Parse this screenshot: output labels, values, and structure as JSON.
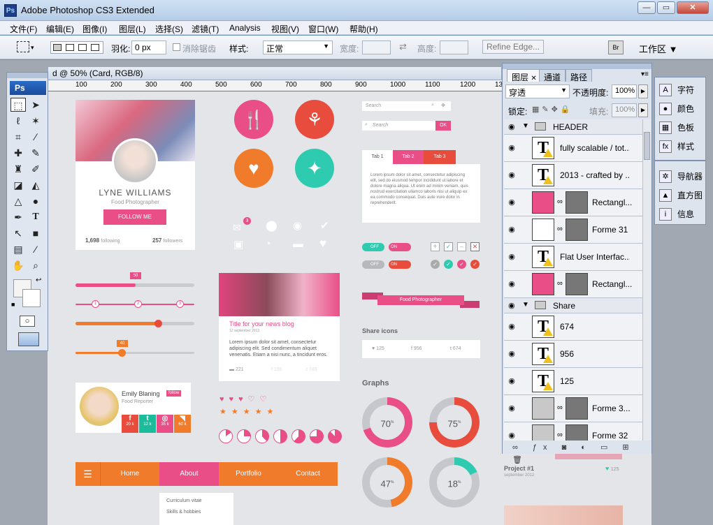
{
  "window": {
    "title": "Adobe Photoshop CS3 Extended",
    "app_icon": "Ps"
  },
  "menu": [
    "文件(F)",
    "编辑(E)",
    "图像(I)",
    "图层(L)",
    "选择(S)",
    "滤镜(T)",
    "Analysis",
    "视图(V)",
    "窗口(W)",
    "帮助(H)"
  ],
  "options": {
    "feather_label": "羽化:",
    "feather_value": "0 px",
    "antialias_label": "消除锯齿",
    "style_label": "样式:",
    "style_value": "正常",
    "width_label": "宽度:",
    "height_label": "高度:",
    "refine_edge": "Refine Edge...",
    "workspace": "工作区 ▼"
  },
  "document": {
    "tab_title": "d @ 50% (Card, RGB/8)",
    "ruler_ticks": [
      "100",
      "200",
      "300",
      "400",
      "500",
      "600",
      "700",
      "800",
      "900",
      "1000",
      "1100",
      "1200",
      "1300"
    ]
  },
  "toolbox": {
    "logo": "Ps"
  },
  "layers_panel": {
    "tabs": [
      "图层",
      "通道",
      "路径"
    ],
    "blend_mode": "穿透",
    "opacity_label": "不透明度:",
    "opacity_value": "100%",
    "lock_label": "锁定:",
    "fill_label": "填充:",
    "fill_value": "100%",
    "rows": [
      {
        "kind": "group",
        "name": "HEADER"
      },
      {
        "kind": "text",
        "name": "fully scalable / tot..."
      },
      {
        "kind": "text",
        "name": "2013 - crafted by ..."
      },
      {
        "kind": "shape",
        "name": "Rectangl...",
        "color": "#e94e86"
      },
      {
        "kind": "shape",
        "name": "Forme 31",
        "color": "#ffffff"
      },
      {
        "kind": "text",
        "name": "Flat User Interfac..."
      },
      {
        "kind": "shape",
        "name": "Rectangl...",
        "color": "#e94e86"
      },
      {
        "kind": "group",
        "name": "Share"
      },
      {
        "kind": "text",
        "name": "674"
      },
      {
        "kind": "text",
        "name": "956"
      },
      {
        "kind": "text",
        "name": "125"
      },
      {
        "kind": "shape",
        "name": "Forme 3...",
        "color": "#c8c8c8"
      },
      {
        "kind": "shape",
        "name": "Forme 32",
        "color": "#c8c8c8"
      }
    ]
  },
  "right_panel": {
    "items": [
      {
        "label": "字符",
        "icon": "A"
      },
      {
        "label": "颜色",
        "icon": "●"
      },
      {
        "label": "色板",
        "icon": "▦"
      },
      {
        "label": "样式",
        "icon": "fx"
      },
      {
        "label": "导航器",
        "icon": "✲"
      },
      {
        "label": "直方图",
        "icon": "▲"
      },
      {
        "label": "信息",
        "icon": "i"
      }
    ]
  },
  "canvas": {
    "profile": {
      "name": "LYNE WILLIAMS",
      "role": "Food Photographer",
      "button": "FOLLOW ME",
      "following_n": "1,698",
      "following_l": "following",
      "followers_n": "257",
      "followers_l": "followers"
    },
    "slider_badges": {
      "a": "50",
      "b": "40"
    },
    "steps": [
      "1",
      "2",
      "3"
    ],
    "user_card": {
      "name": "Emily Blaning",
      "badge": "follow",
      "role": "Food Reporter",
      "stats": [
        {
          "icon": "f",
          "n": "20 k",
          "c": "#e74c3c"
        },
        {
          "icon": "t",
          "n": "12 k",
          "c": "#1abc9c"
        },
        {
          "icon": "◎",
          "n": "35 k",
          "c": "#e94e86"
        },
        {
          "icon": "◥",
          "n": "60 k",
          "c": "#f07b2b"
        }
      ]
    },
    "nav": {
      "items": [
        "Home",
        "About",
        "Portfolio",
        "Contact"
      ],
      "dropdown": [
        "Curriculum vitae",
        "Skills & hobbies"
      ]
    },
    "blog": {
      "title": "Title for your news blog",
      "date": "12 september 2013",
      "body": "Lorem ipsum dolor sit amet, consectetur adipiscing elit. Sed condimentum aliquet venenatis. Etiam a nisi nunc, a tincidunt eros.",
      "c1": "221",
      "c2": "190",
      "c3": "745"
    },
    "search": {
      "placeholder1": "Search",
      "placeholder2": "Search",
      "ok": "OK"
    },
    "tabs": {
      "labels": [
        "Tab 1",
        "Tab 2",
        "Tab 3"
      ],
      "body": "Lorem ipsum dolor sit amet, consectetur adipiscing elit, sed do eiusmod tempor incididunt ut labore et dolore magna aliqua. Ut enim ad minim veniam, quis nostrud exercitation ullamco laboris nisi ut aliquip ex ea commodo consequat. Duis aute irure dolor in reprehenderit."
    },
    "notif": "3",
    "toggles": {
      "off": "OFF",
      "on": "ON"
    },
    "ribbon": "Food Photographer",
    "share": {
      "title": "Share icons",
      "n1": "125",
      "n2": "956",
      "n3": "674"
    },
    "graphs": {
      "title": "Graphs",
      "items": [
        {
          "v": 70,
          "c": "#e94e86"
        },
        {
          "v": 75,
          "c": "#e74c3c"
        },
        {
          "v": 47,
          "c": "#f07b2b"
        },
        {
          "v": 18,
          "c": "#2ecbb1"
        }
      ]
    },
    "project": {
      "title": "Project #1",
      "date": "september 2012",
      "likes": "125"
    }
  }
}
